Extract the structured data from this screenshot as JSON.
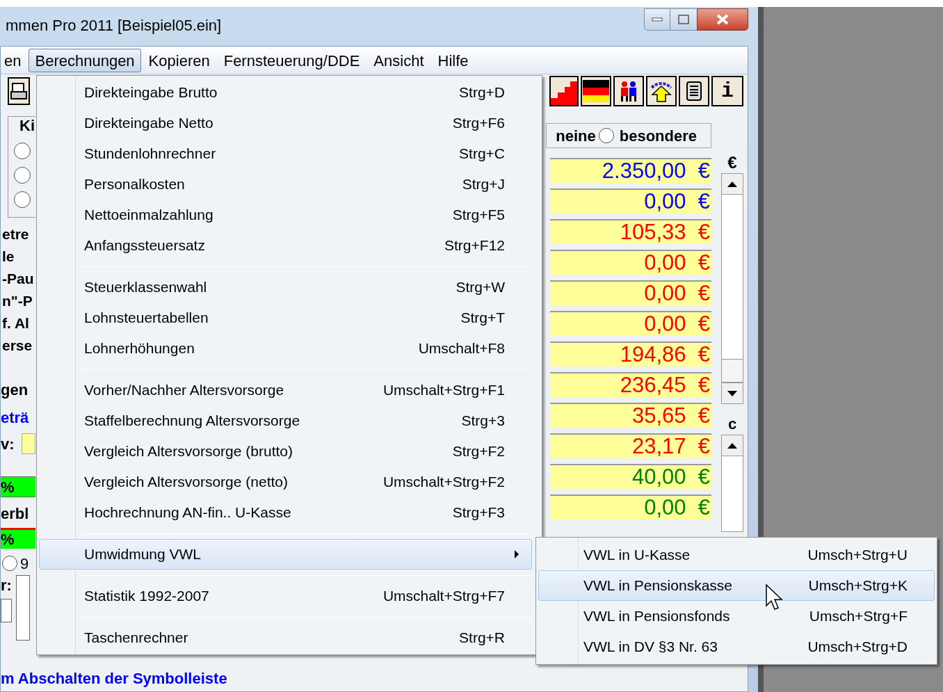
{
  "window": {
    "title": "mmen Pro 2011 [Beispiel05.ein]"
  },
  "menu_bar": [
    {
      "label": "en",
      "selected": false
    },
    {
      "label": "Berechnungen",
      "selected": true
    },
    {
      "label": "Kopieren",
      "selected": false
    },
    {
      "label": "Fernsteuerung/DDE",
      "selected": false
    },
    {
      "label": "Ansicht",
      "selected": false
    },
    {
      "label": "Hilfe",
      "selected": false
    }
  ],
  "toolbar": {
    "info_label": "i"
  },
  "left_panel": {
    "group_label": "Ki",
    "radios": [
      {
        "selected": false
      },
      {
        "selected": false
      },
      {
        "selected": false
      }
    ],
    "labels": [
      "etre",
      "le",
      "-Pau",
      "n\"-P",
      "f. Al",
      "erse"
    ],
    "label_2": "gen",
    "link": "eträ",
    "field_label": "v:",
    "bar_1": "%",
    "label_3": "erbl",
    "bar_2": "%",
    "radio_label": "9",
    "radio_selected": false,
    "field_label_2": "r:"
  },
  "right_panel": {
    "radio_left_text": "neine",
    "radio": {
      "label": "besondere",
      "selected": false
    },
    "unit_1": "€",
    "unit_2": "c",
    "values": [
      {
        "text": "2.350,00  €",
        "color": "#0000ff"
      },
      {
        "text": "0,00  €",
        "color": "#0000ff"
      },
      {
        "text": "105,33  €",
        "color": "#ff0000"
      },
      {
        "text": "0,00  €",
        "color": "#ff0000"
      },
      {
        "text": "0,00  €",
        "color": "#ff0000"
      },
      {
        "text": "0,00  €",
        "color": "#ff0000"
      },
      {
        "text": "194,86  €",
        "color": "#ff0000"
      },
      {
        "text": "236,45  €",
        "color": "#ff0000"
      },
      {
        "text": "35,65  €",
        "color": "#ff0000"
      },
      {
        "text": "23,17  €",
        "color": "#ff0000"
      },
      {
        "text": "40,00  €",
        "color": "#008000"
      },
      {
        "text": "0,00  €",
        "color": "#008000"
      }
    ]
  },
  "status_text": "m Abschalten der Symbolleiste",
  "dropdown": [
    {
      "kind": "item",
      "label": "Direkteingabe Brutto",
      "shortcut": "Strg+D",
      "selected": false
    },
    {
      "kind": "item",
      "label": "Direkteingabe Netto",
      "shortcut": "Strg+F6",
      "selected": false
    },
    {
      "kind": "item",
      "label": "Stundenlohnrechner",
      "shortcut": "Strg+C",
      "selected": false
    },
    {
      "kind": "item",
      "label": "Personalkosten",
      "shortcut": "Strg+J",
      "selected": false
    },
    {
      "kind": "item",
      "label": "Nettoeinmalzahlung",
      "shortcut": "Strg+F5",
      "selected": false
    },
    {
      "kind": "item",
      "label": "Anfangssteuersatz",
      "shortcut": "Strg+F12",
      "selected": false
    },
    {
      "kind": "separator"
    },
    {
      "kind": "item",
      "label": "Steuerklassenwahl",
      "shortcut": "Strg+W",
      "selected": false
    },
    {
      "kind": "item",
      "label": "Lohnsteuertabellen",
      "shortcut": "Strg+T",
      "selected": false
    },
    {
      "kind": "item",
      "label": "Lohnerhöhungen",
      "shortcut": "Umschalt+F8",
      "selected": false
    },
    {
      "kind": "separator"
    },
    {
      "kind": "item",
      "label": "Vorher/Nachher Altersvorsorge",
      "shortcut": "Umschalt+Strg+F1",
      "selected": false
    },
    {
      "kind": "item",
      "label": "Staffelberechnung Altersvorsorge",
      "shortcut": "Strg+3",
      "selected": false
    },
    {
      "kind": "item",
      "label": "Vergleich Altersvorsorge (brutto)",
      "shortcut": "Strg+F2",
      "selected": false
    },
    {
      "kind": "item",
      "label": "Vergleich Altersvorsorge (netto)",
      "shortcut": "Umschalt+Strg+F2",
      "selected": false
    },
    {
      "kind": "item",
      "label": "Hochrechnung AN-fin.. U-Kasse",
      "shortcut": "Strg+F3",
      "selected": false
    },
    {
      "kind": "separator"
    },
    {
      "kind": "submenu",
      "label": "Umwidmung VWL",
      "selected": true
    },
    {
      "kind": "separator"
    },
    {
      "kind": "item",
      "label": "Statistik 1992-2007",
      "shortcut": "Umschalt+Strg+F7",
      "selected": false
    },
    {
      "kind": "separator"
    },
    {
      "kind": "item",
      "label": "Taschenrechner",
      "shortcut": "Strg+R",
      "selected": false
    }
  ],
  "submenu": [
    {
      "label": "VWL in U-Kasse",
      "shortcut": "Umsch+Strg+U",
      "selected": false
    },
    {
      "label": "VWL in Pensionskasse",
      "shortcut": "Umsch+Strg+K",
      "selected": true
    },
    {
      "label": "VWL in Pensionsfonds",
      "shortcut": "Umsch+Strg+F",
      "selected": false
    },
    {
      "label": "VWL in DV §3 Nr. 63",
      "shortcut": "Umsch+Strg+D",
      "selected": false
    }
  ]
}
